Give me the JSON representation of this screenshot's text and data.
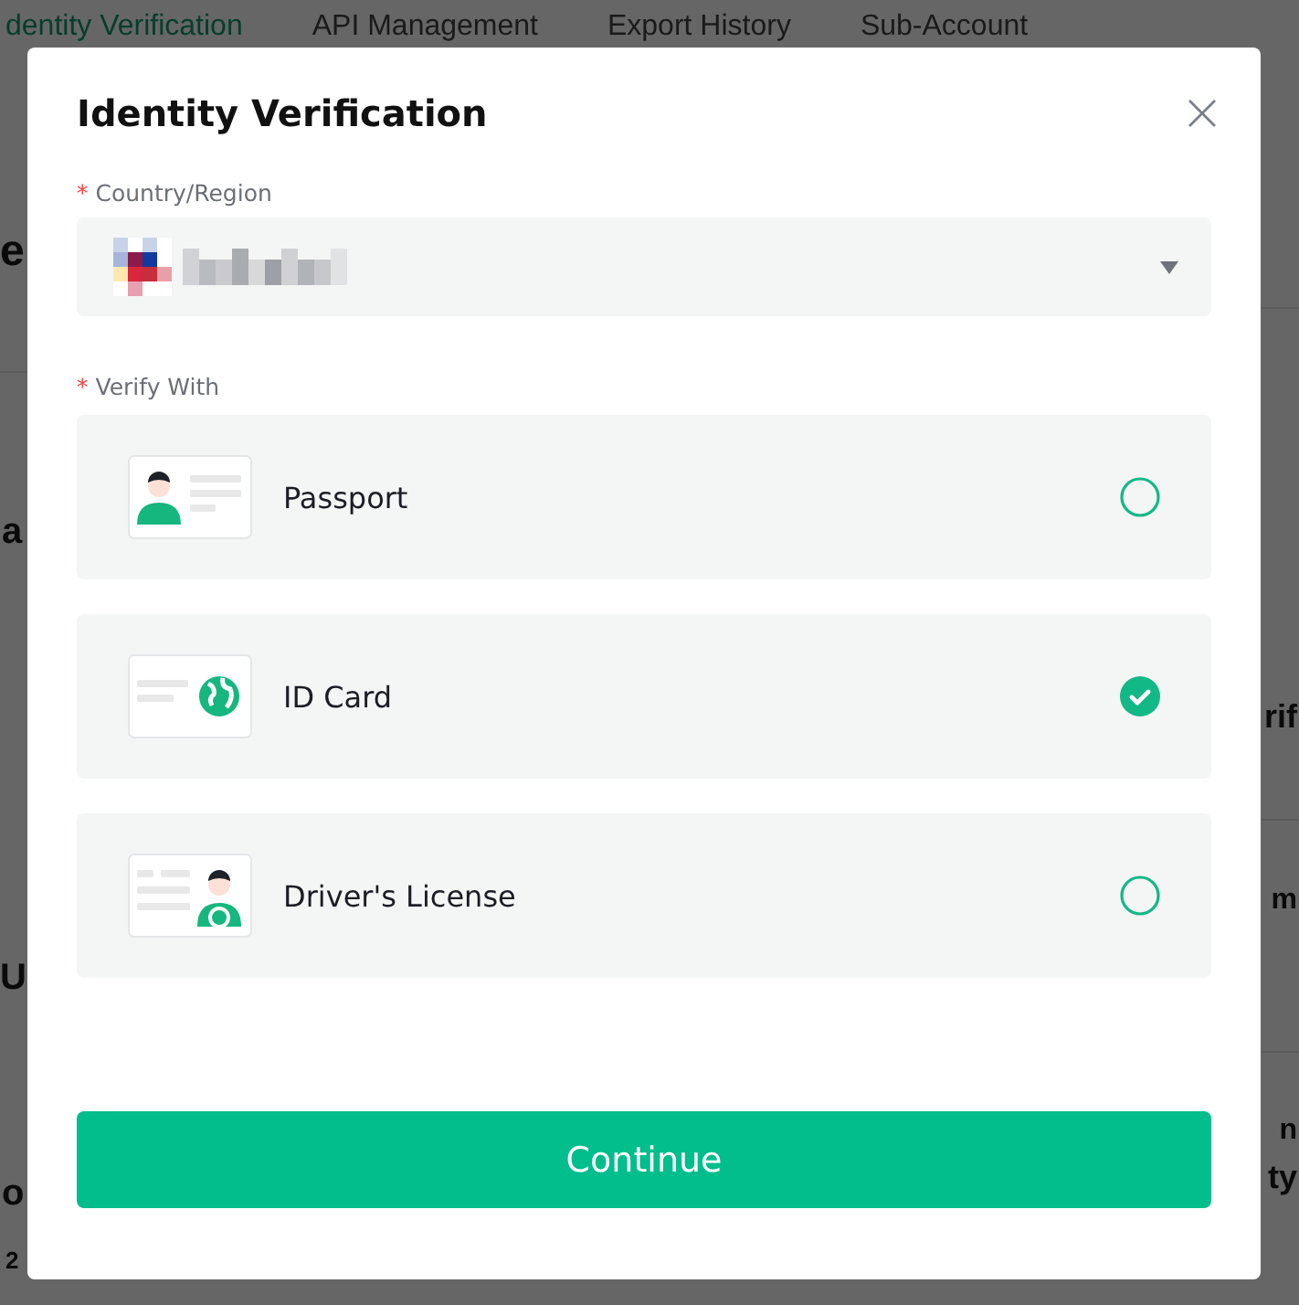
{
  "background": {
    "tabs": [
      {
        "label": "dentity Verification",
        "selected": true
      },
      {
        "label": "API Management",
        "selected": false
      },
      {
        "label": "Export History",
        "selected": false
      },
      {
        "label": "Sub-Account",
        "selected": false
      }
    ],
    "fragments": [
      {
        "text": "e"
      },
      {
        "text": "a"
      },
      {
        "text": "rif"
      },
      {
        "text": "m"
      },
      {
        "text": "U"
      },
      {
        "text": "n"
      },
      {
        "text": "ty"
      },
      {
        "text": "o"
      },
      {
        "text": "2"
      }
    ]
  },
  "dialog": {
    "title": "Identity Verification",
    "country": {
      "label": "Country/Region",
      "required": true,
      "marker": "*"
    },
    "verify_with": {
      "label": "Verify With",
      "required": true,
      "marker": "*",
      "options": [
        {
          "label": "Passport",
          "kind": "passport",
          "selected": false
        },
        {
          "label": "ID Card",
          "kind": "id_card",
          "selected": true
        },
        {
          "label": "Driver's License",
          "kind": "license",
          "selected": false
        }
      ]
    },
    "button": "Continue"
  }
}
